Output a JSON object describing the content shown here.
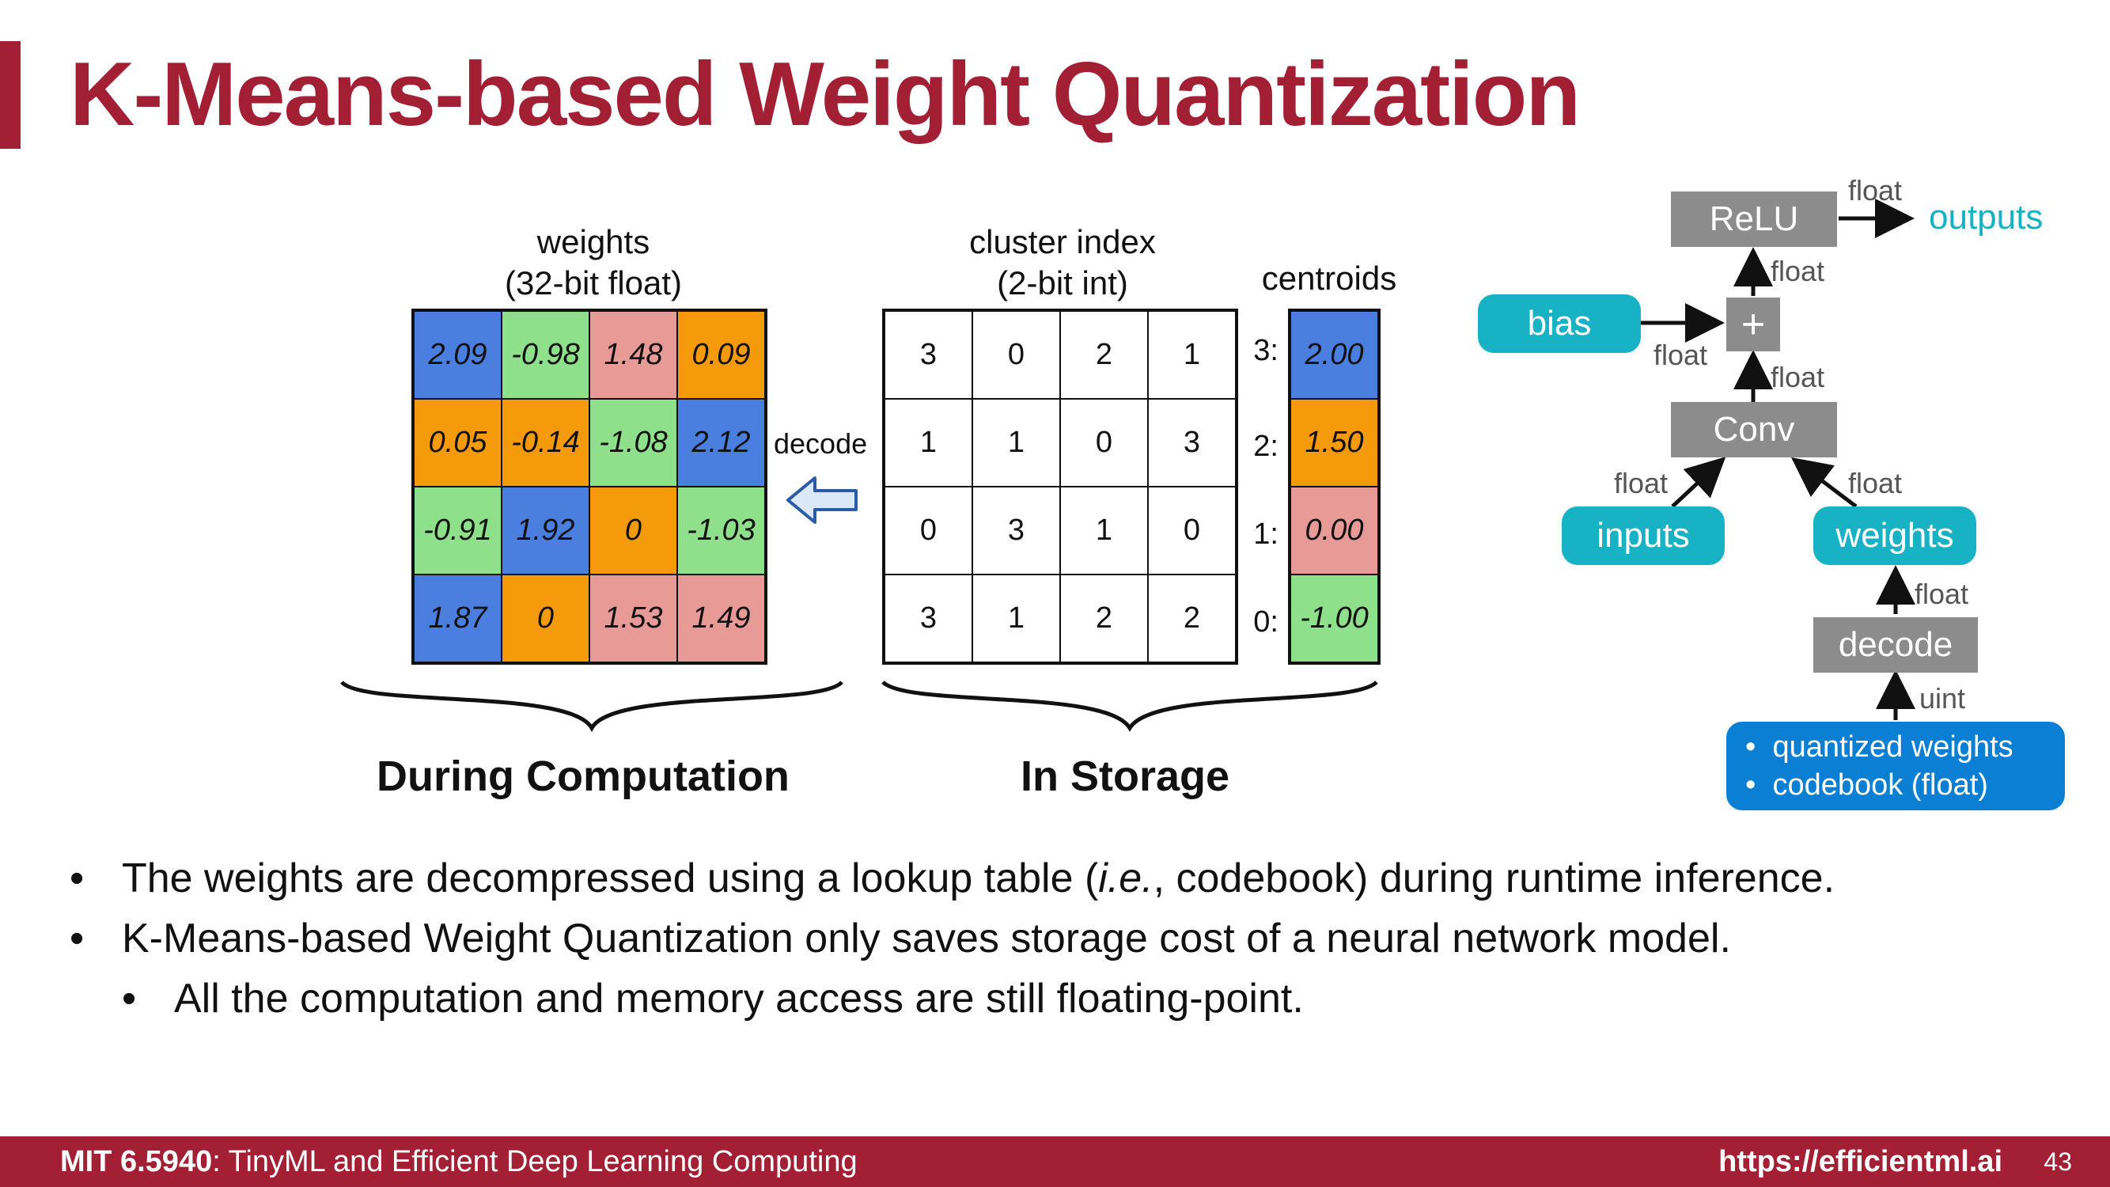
{
  "title": "K-Means-based Weight Quantization",
  "weights_caption": [
    "weights",
    "(32-bit float)"
  ],
  "index_caption": [
    "cluster index",
    "(2-bit int)"
  ],
  "centroids_caption": "centroids",
  "decode_label": "decode",
  "weights": [
    [
      "2.09",
      "-0.98",
      "1.48",
      "0.09"
    ],
    [
      "0.05",
      "-0.14",
      "-1.08",
      "2.12"
    ],
    [
      "-0.91",
      "1.92",
      "0",
      "-1.03"
    ],
    [
      "1.87",
      "0",
      "1.53",
      "1.49"
    ]
  ],
  "weight_colors": [
    [
      "#4a7fe0",
      "#8ee08a",
      "#e89a97",
      "#f59a0a"
    ],
    [
      "#f59a0a",
      "#f59a0a",
      "#8ee08a",
      "#4a7fe0"
    ],
    [
      "#8ee08a",
      "#4a7fe0",
      "#f59a0a",
      "#8ee08a"
    ],
    [
      "#4a7fe0",
      "#f59a0a",
      "#e89a97",
      "#e89a97"
    ]
  ],
  "cluster_index": [
    [
      "3",
      "0",
      "2",
      "1"
    ],
    [
      "1",
      "1",
      "0",
      "3"
    ],
    [
      "0",
      "3",
      "1",
      "0"
    ],
    [
      "3",
      "1",
      "2",
      "2"
    ]
  ],
  "centroid_indices": [
    "3:",
    "2:",
    "1:",
    "0:"
  ],
  "centroids": [
    "2.00",
    "1.50",
    "0.00",
    "-1.00"
  ],
  "centroid_colors": [
    "#4a7fe0",
    "#f59a0a",
    "#e89a97",
    "#8ee08a"
  ],
  "section_labels": {
    "computation": "During Computation",
    "storage": "In Storage"
  },
  "graph": {
    "relu": "ReLU",
    "outputs": "outputs",
    "bias": "bias",
    "plus": "+",
    "conv": "Conv",
    "inputs": "inputs",
    "weights": "weights",
    "decode": "decode",
    "float_label": "float",
    "uint_label": "uint",
    "storage_items": [
      "quantized weights",
      "codebook (float)"
    ]
  },
  "bullets": [
    {
      "pre": "The weights are decompressed using a lookup table (",
      "em": "i.e.",
      "post": ", codebook) during runtime inference."
    },
    {
      "text": "K-Means-based Weight Quantization only saves storage cost of a neural network model."
    },
    {
      "text": "All the computation and memory access are still floating-point."
    }
  ],
  "bullet_mark": "•",
  "footer": {
    "course_code": "MIT 6.5940",
    "course_name": ": TinyML and Efficient Deep Learning Computing",
    "url": "https://efficientml.ai",
    "page": "43"
  }
}
